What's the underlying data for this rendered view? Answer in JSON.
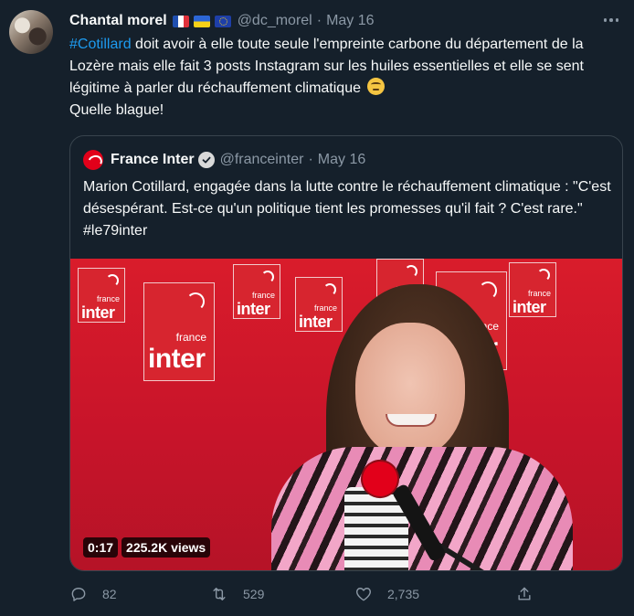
{
  "tweet": {
    "display_name": "Chantal morel",
    "flags": [
      "flag-france",
      "flag-ukraine",
      "flag-eu"
    ],
    "handle": "@dc_morel",
    "separator": "·",
    "date": "May 16",
    "text": {
      "hashtag": "#Cotillard",
      "body": " doit avoir à elle toute seule l'empreinte carbone du département de la Lozère mais elle fait 3 posts Instagram sur les huiles essentielles et elle se sent légitime à parler du réchauffement climatique",
      "emoji": "face-with-rolling-eyes",
      "line2": "Quelle blague!"
    }
  },
  "quote": {
    "display_name": "France Inter",
    "verified": true,
    "handle": "@franceinter",
    "separator": "·",
    "date": "May 16",
    "text": "Marion Cotillard, engagée dans la lutte contre le réchauffement climatique : \"C'est désespérant. Est-ce qu'un politique tient les promesses qu'il fait ? C'est rare.\" #le79inter",
    "media": {
      "type": "video",
      "duration": "0:17",
      "views": "225.2K views",
      "logo_small": "france",
      "logo_big": "inter"
    }
  },
  "actions": {
    "reply": {
      "icon": "reply-icon",
      "count": "82"
    },
    "retweet": {
      "icon": "retweet-icon",
      "count": "529"
    },
    "like": {
      "icon": "heart-icon",
      "count": "2,735"
    },
    "share": {
      "icon": "share-icon"
    }
  },
  "colors": {
    "background": "#15202b",
    "text": "#f7f9f9",
    "muted": "#8b98a5",
    "accent": "#1d9bf0",
    "border": "#38444d",
    "brand_red": "#e2001a"
  }
}
